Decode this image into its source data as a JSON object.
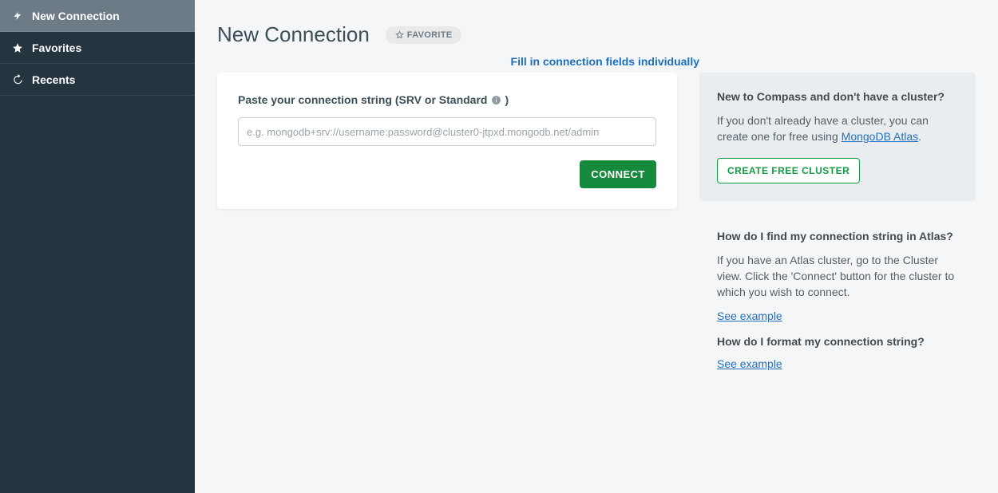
{
  "sidebar": {
    "items": [
      {
        "label": "New Connection"
      },
      {
        "label": "Favorites"
      },
      {
        "label": "Recents"
      }
    ]
  },
  "header": {
    "title": "New Connection",
    "favorite_label": "FAVORITE",
    "fill_link": "Fill in connection fields individually"
  },
  "form": {
    "label_prefix": "Paste your connection string (SRV or Standard ",
    "label_suffix": ")",
    "placeholder": "e.g. mongodb+srv://username:password@cluster0-jtpxd.mongodb.net/admin",
    "value": "",
    "connect_label": "CONNECT"
  },
  "help": {
    "new_heading": "New to Compass and don't have a cluster?",
    "new_text_a": "If you don't already have a cluster, you can create one for free using ",
    "atlas_link": "MongoDB Atlas",
    "new_text_b": ".",
    "create_cluster_label": "CREATE FREE CLUSTER",
    "find_heading": "How do I find my connection string in Atlas?",
    "find_text": "If you have an Atlas cluster, go to the Cluster view. Click the 'Connect' button for the cluster to which you wish to connect.",
    "see_example": "See example",
    "format_heading": "How do I format my connection string?"
  }
}
